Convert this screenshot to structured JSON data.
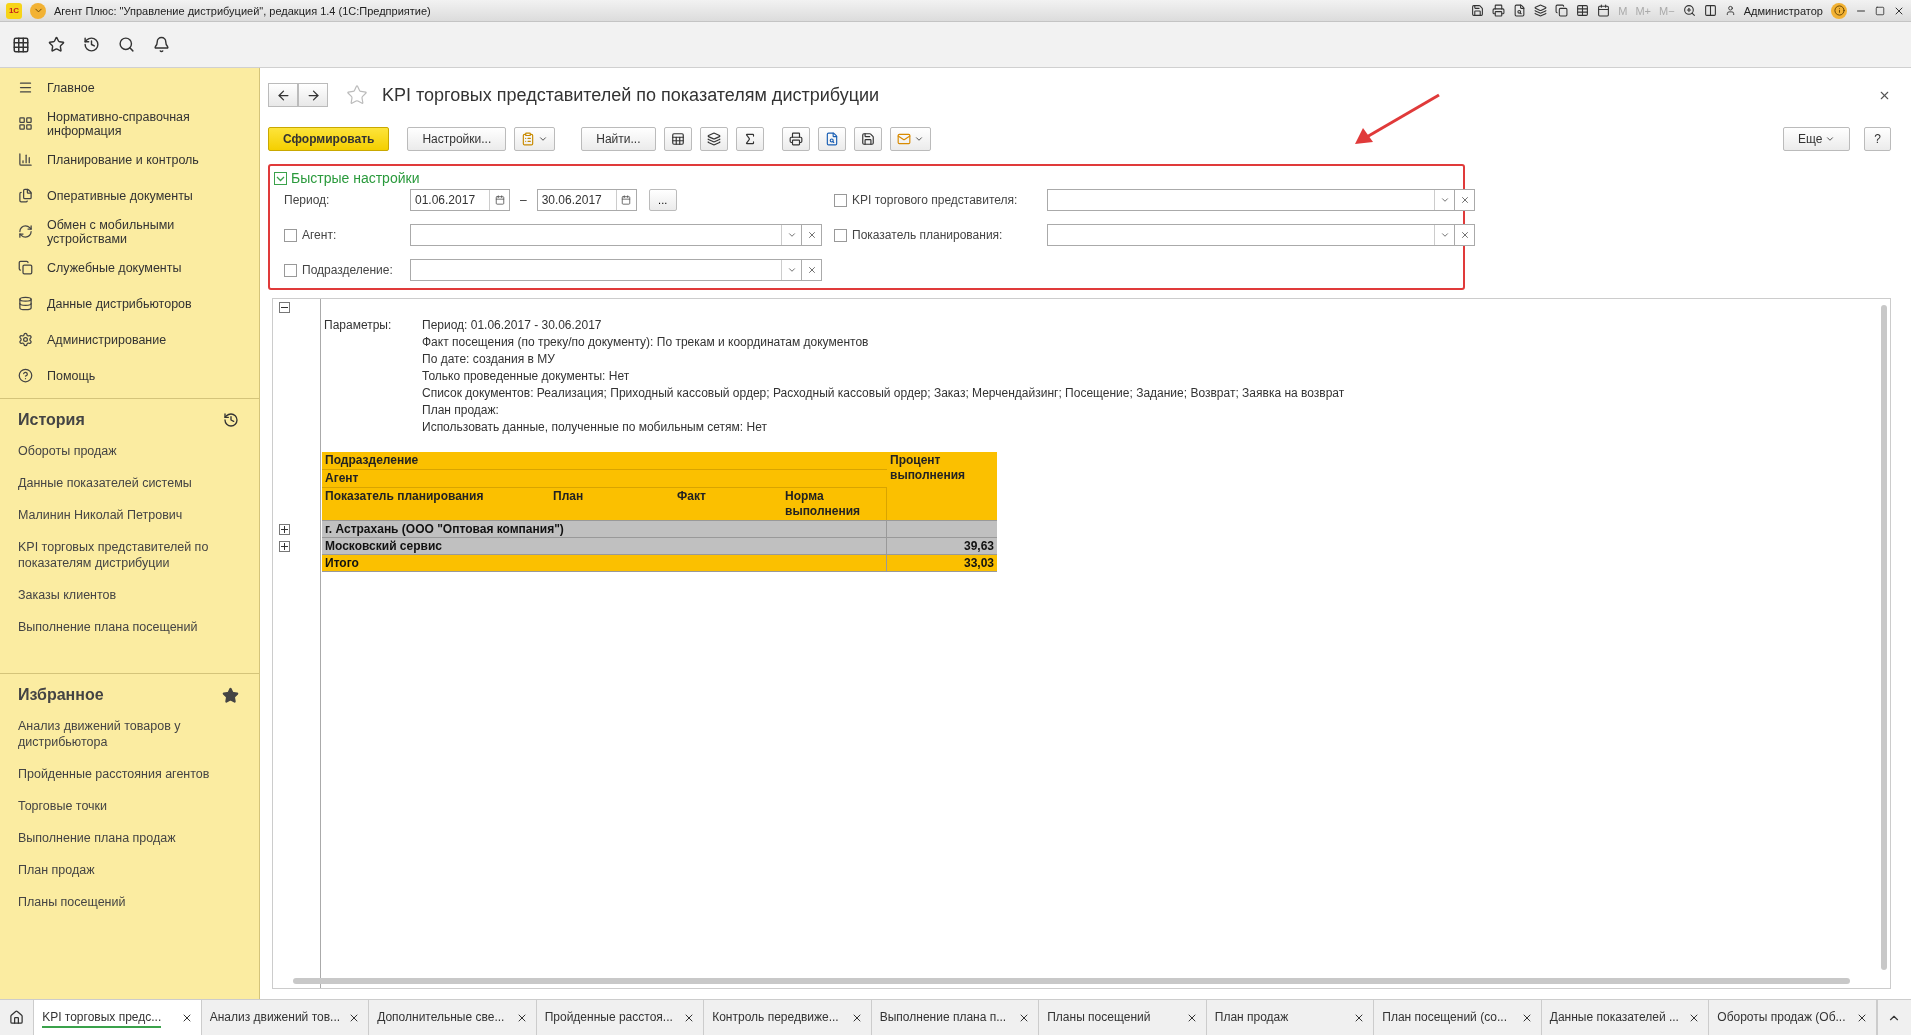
{
  "window": {
    "logo": "1С",
    "title": "Агент Плюс: \"Управление дистрибуцией\", редакция 1.4  (1С:Предприятие)",
    "memory_buttons": [
      "M",
      "M+",
      "M−"
    ],
    "user": "Администратор"
  },
  "sidebar": {
    "sections": [
      {
        "label": "Главное"
      },
      {
        "label": "Нормативно-справочная информация"
      },
      {
        "label": "Планирование и контроль"
      },
      {
        "label": "Оперативные документы"
      },
      {
        "label": "Обмен с мобильными устройствами"
      },
      {
        "label": "Служебные документы"
      },
      {
        "label": "Данные дистрибьюторов"
      },
      {
        "label": "Администрирование"
      },
      {
        "label": "Помощь"
      }
    ],
    "history": {
      "title": "История",
      "items": [
        "Обороты продаж",
        "Данные показателей системы",
        "Малинин Николай Петрович",
        "KPI торговых представителей по показателям дистрибуции",
        "Заказы клиентов",
        "Выполнение плана посещений"
      ]
    },
    "favorites": {
      "title": "Избранное",
      "items": [
        "Анализ движений товаров у дистрибьютора",
        "Пройденные расстояния агентов",
        "Торговые точки",
        "Выполнение плана продаж",
        "План продаж",
        "Планы посещений"
      ]
    }
  },
  "form": {
    "title": "KPI торговых представителей по показателям дистрибуции",
    "generate_button": "Сформировать",
    "settings_button": "Настройки...",
    "find_button": "Найти...",
    "more_button": "Еще",
    "help_button": "?"
  },
  "quick_settings": {
    "title": "Быстрые настройки",
    "expanded": true,
    "period": {
      "label": "Период:",
      "from": "01.06.2017",
      "dash": "–",
      "to": "30.06.2017",
      "choose_button": "..."
    },
    "left_filters": [
      {
        "label": "Агент:",
        "checked": false
      },
      {
        "label": "Подразделение:",
        "checked": false
      }
    ],
    "right_filters": [
      {
        "label": "KPI торгового представителя:",
        "checked": false
      },
      {
        "label": "Показатель планирования:",
        "checked": false
      }
    ]
  },
  "report": {
    "params_expanded": true,
    "params_label": "Параметры:",
    "params": [
      "Период: 01.06.2017 - 30.06.2017",
      "Факт посещения (по треку/по документу): По трекам и координатам документов",
      "По дате: создания в МУ",
      "Только проведенные документы: Нет",
      "Список документов: Реализация; Приходный кассовый ордер; Расходный кассовый ордер; Заказ; Мерчендайзинг; Посещение; Задание; Возврат; Заявка на возврат",
      "План продаж:",
      "Использовать данные, полученные по мобильным сетям: Нет"
    ],
    "group_headers": [
      "Подразделение",
      "Агент"
    ],
    "columns": [
      "Показатель планирования",
      "План",
      "Факт",
      "Норма выполнения"
    ],
    "percent_header": "Процент выполнения",
    "rows": [
      {
        "kind": "group",
        "label": "г. Астрахань (ООО \"Оптовая компания\")",
        "expanded": false
      },
      {
        "kind": "group",
        "label": "Московский сервис",
        "value": "39,63",
        "expanded": false
      },
      {
        "kind": "total",
        "label": "Итого",
        "value": "33,03"
      }
    ]
  },
  "open_tabs": [
    {
      "label": "KPI торговых предс...",
      "selected": true
    },
    {
      "label": "Анализ движений тов...",
      "selected": false
    },
    {
      "label": "Дополнительные све...",
      "selected": false
    },
    {
      "label": "Пройденные расстоя...",
      "selected": false
    },
    {
      "label": "Контроль передвиже...",
      "selected": false
    },
    {
      "label": "Выполнение плана п...",
      "selected": false
    },
    {
      "label": "Планы посещений",
      "selected": false
    },
    {
      "label": "План продаж",
      "selected": false
    },
    {
      "label": "План посещений  (со...",
      "selected": false
    },
    {
      "label": "Данные показателей ...",
      "selected": false
    },
    {
      "label": "Обороты продаж (Об...",
      "selected": false
    }
  ]
}
